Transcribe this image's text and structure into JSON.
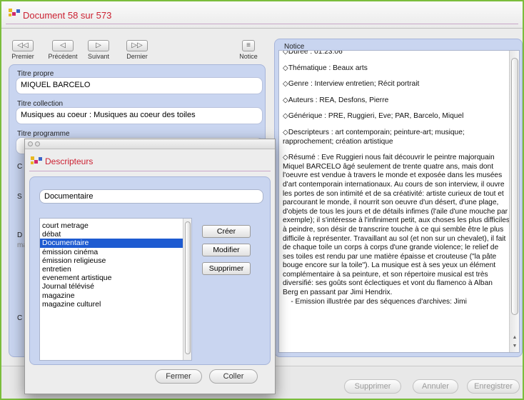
{
  "window": {
    "title": "Document 58 sur 573"
  },
  "nav": {
    "first": "Premier",
    "previous": "Précédent",
    "next": "Suivant",
    "last": "Dernier",
    "notice": "Notice"
  },
  "fields": {
    "titre_propre_label": "Titre propre",
    "titre_propre_value": "MIQUEL BARCELO",
    "titre_collection_label": "Titre collection",
    "titre_collection_value": "Musiques au coeur : Musiques au coeur des toiles",
    "titre_programme_label": "Titre programme",
    "partial_labels": [
      "C",
      "S",
      "D",
      "C"
    ],
    "partial_value": "ma"
  },
  "notice": {
    "label": "Notice",
    "paragraphs": [
      "◇Durée : 01:23:06",
      "◇Thématique : Beaux arts",
      "◇Genre : Interview entretien; Récit portrait",
      "◇Auteurs : REA, Desfons, Pierre",
      "◇Générique : PRE, Ruggieri, Eve; PAR, Barcelo, Miquel",
      "◇Descripteurs : art contemporain; peinture-art; musique; rapprochement; création artistique",
      "◇Résumé : Eve Ruggieri nous fait découvrir le peintre majorquain Miquel BARCELO âgé seulement de trente quatre ans, mais dont l'oeuvre est vendue à travers le monde et exposée dans les musées d'art contemporain internationaux. Au cours de son interview, il ouvre les portes de son intimité et de sa créativité: artiste curieux de tout et parcourant le monde, il nourrit son oeuvre d'un désert, d'une plage, d'objets de tous les jours et de détails infimes (l'aile d'une mouche par exemple); il s'intéresse à l'infiniment petit, aux choses les plus difficiles à peindre, son désir de transcrire touche à ce qui semble être le plus difficile à représenter. Travaillant au sol (et non sur un chevalet), il fait de chaque toile un corps à corps d'une grande violence; le relief de ses toiles est rendu par une matière épaisse et crouteuse (\"la pâte bouge encore sur la toile\"). La musique est à ses yeux un élément complémentaire à sa peinture, et son répertoire musical est très diversifié: ses goûts sont éclectiques et vont du flamenco à Alban Berg en passant par Jimi Hendrix.",
      "    - Emission illustrée par des séquences d'archives: Jimi"
    ]
  },
  "bottom": {
    "delete": "Supprimer",
    "cancel": "Annuler",
    "save": "Enregistrer"
  },
  "dialog": {
    "title": "Descripteurs",
    "input_value": "Documentaire",
    "items": [
      "court metrage",
      "débat",
      "Documentaire",
      "émission cinéma",
      "émission religieuse",
      "entretien",
      "evenement artistique",
      "Journal télévisé",
      "magazine",
      "magazine culturel"
    ],
    "selected_index": 2,
    "create": "Créer",
    "modify": "Modifier",
    "delete": "Supprimer",
    "close": "Fermer",
    "paste": "Coller"
  }
}
